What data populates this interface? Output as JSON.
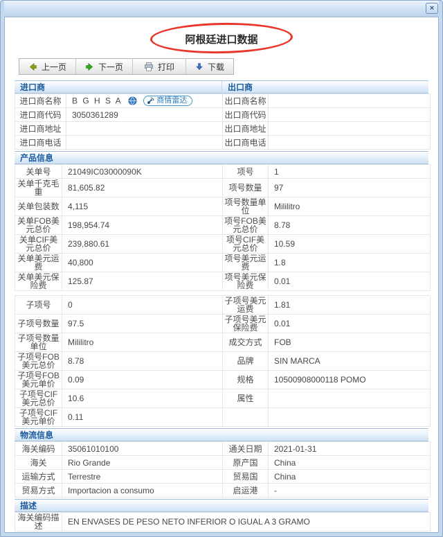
{
  "colors": {
    "accent_blue": "#1c5a9e",
    "annotation_red": "#e8362b",
    "badge_blue": "#2e7cb8"
  },
  "window": {
    "close_glyph": "×"
  },
  "page_title": "阿根廷进口数据",
  "toolbar": {
    "prev_label": "上一页",
    "next_label": "下一页",
    "print_label": "打印",
    "download_label": "下载"
  },
  "importer": {
    "header_left": "进口商",
    "header_right": "出口商",
    "radar_label": "商情雷达",
    "rows": [
      [
        "进口商名称",
        "B G H S A",
        "出口商名称",
        ""
      ],
      [
        "进口商代码",
        "3050361289",
        "出口商代码",
        ""
      ],
      [
        "进口商地址",
        "",
        "出口商地址",
        ""
      ],
      [
        "进口商电话",
        "",
        "出口商电话",
        ""
      ]
    ]
  },
  "product": {
    "header": "产品信息",
    "t1": [
      [
        "关单号",
        "21049IC03000090K",
        "项号",
        "1"
      ],
      [
        "关单千克毛重",
        "81,605.82",
        "项号数量",
        "97"
      ],
      [
        "关单包装数",
        "4,115",
        "项号数量单位",
        "Mililitro"
      ],
      [
        "关单FOB美元总价",
        "198,954.74",
        "项号FOB美元总价",
        "8.78"
      ],
      [
        "关单CIF美元总价",
        "239,880.61",
        "项号CIF美元总价",
        "10.59"
      ],
      [
        "关单美元运费",
        "40,800",
        "项号美元运费",
        "1.8"
      ],
      [
        "关单美元保险费",
        "125.87",
        "项号美元保险费",
        "0.01"
      ]
    ],
    "t2": [
      [
        "子项号",
        "0",
        "子项号美元运费",
        "1.81"
      ],
      [
        "子项号数量",
        "97.5",
        "子项号美元保险费",
        "0.01"
      ],
      [
        "子项号数量单位",
        "Mililitro",
        "成交方式",
        "FOB"
      ],
      [
        "子项号FOB美元总价",
        "8.78",
        "品牌",
        "SIN MARCA"
      ],
      [
        "子项号FOB美元单价",
        "0.09",
        "规格",
        "10500908000118 POMO"
      ],
      [
        "子项号CIF美元总价",
        "10.6",
        "属性",
        ""
      ],
      [
        "子项号CIF美元单价",
        "0.11",
        "",
        ""
      ]
    ]
  },
  "logistics": {
    "header": "物流信息",
    "rows": [
      [
        "海关编码",
        "35061010100",
        "通关日期",
        "2021-01-31"
      ],
      [
        "海关",
        "Rio Grande",
        "原产国",
        "China"
      ],
      [
        "运输方式",
        "Terrestre",
        "贸易国",
        "China"
      ],
      [
        "贸易方式",
        "Importacion a consumo",
        "启运港",
        "-"
      ]
    ]
  },
  "description": {
    "header": "描述",
    "label": "海关编码描述",
    "value": "EN ENVASES DE PESO NETO INFERIOR O IGUAL A 3 GRAMO"
  }
}
